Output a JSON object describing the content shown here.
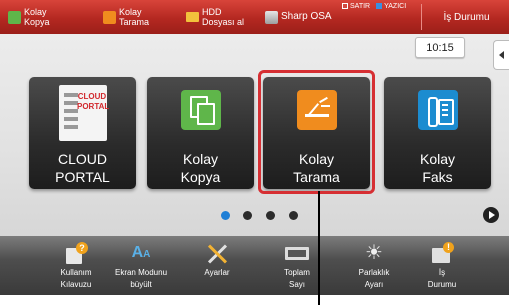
{
  "topbar": {
    "shortcuts": [
      {
        "line1": "Kolay",
        "line2": "Kopya",
        "icon": "copy-icon",
        "color": "#5fb64a"
      },
      {
        "line1": "Kolay",
        "line2": "Tarama",
        "icon": "scan-icon",
        "color": "#f08c1e"
      },
      {
        "line1": "HDD",
        "line2": "Dosyası al",
        "icon": "folder-icon",
        "color": "#f2c13c"
      },
      {
        "line1": "Sharp OSA",
        "line2": "",
        "icon": "osa-icon",
        "color": "#c9c9c9"
      }
    ],
    "mode_indicators": [
      {
        "label": "SATIR",
        "color": "#d24a41"
      },
      {
        "label": "YAZICI",
        "color": "#3a8fe0"
      }
    ],
    "job_status": "İş Durumu"
  },
  "clock": "10:15",
  "tiles": [
    {
      "line1": "CLOUD PORTAL",
      "line2": "",
      "icon": "cloud-portal-icon",
      "logo_text": [
        "CLOUD",
        "PORTAL"
      ]
    },
    {
      "line1": "Kolay",
      "line2": "Kopya",
      "icon": "copy-icon",
      "color": "#5fb64a"
    },
    {
      "line1": "Kolay",
      "line2": "Tarama",
      "icon": "scan-icon",
      "color": "#f08c1e"
    },
    {
      "line1": "Kolay",
      "line2": "Faks",
      "icon": "fax-icon",
      "color": "#1c8cd0"
    }
  ],
  "highlighted_tile": "Kolay Tarama",
  "pagination": {
    "pages": 4,
    "current": 1
  },
  "bottombar": [
    {
      "line1": "Kullanım",
      "line2": "Kılavuzu",
      "icon": "manual-icon"
    },
    {
      "line1": "Ekran Modunu",
      "line2": "büyült",
      "icon": "display-zoom-icon"
    },
    {
      "line1": "Ayarlar",
      "line2": "",
      "icon": "settings-tools-icon"
    },
    {
      "line1": "Toplam",
      "line2": "Sayı",
      "icon": "total-count-icon"
    },
    {
      "line1": "Parlaklık",
      "line2": "Ayarı",
      "icon": "brightness-icon"
    },
    {
      "line1": "İş",
      "line2": "Durumu",
      "icon": "job-status-icon"
    }
  ]
}
